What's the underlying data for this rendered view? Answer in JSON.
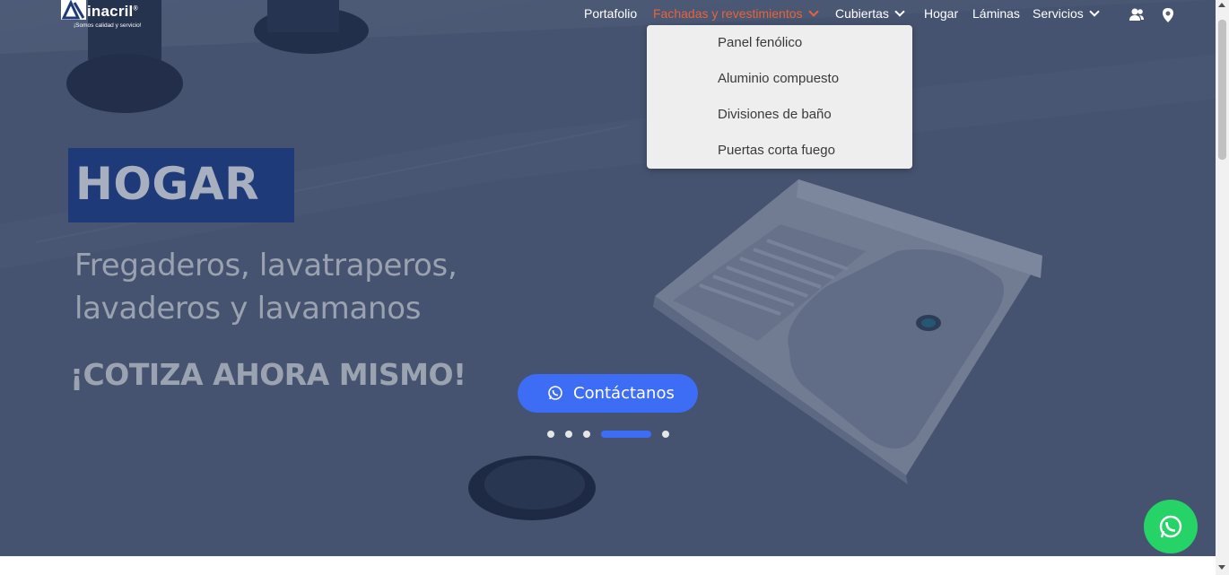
{
  "brand": {
    "name": "inacril",
    "registered_mark": "®",
    "tagline": "¡Somos calidad y servicio!"
  },
  "nav": {
    "items": [
      {
        "label": "Portafolio",
        "has_dropdown": false,
        "active": false
      },
      {
        "label": "Fachadas y revestimientos",
        "has_dropdown": true,
        "active": true
      },
      {
        "label": "Cubiertas",
        "has_dropdown": true,
        "active": false
      },
      {
        "label": "Hogar",
        "has_dropdown": false,
        "active": false
      },
      {
        "label": "Láminas",
        "has_dropdown": false,
        "active": false
      },
      {
        "label": "Servicios",
        "has_dropdown": true,
        "active": false
      }
    ],
    "icons": [
      "users-icon",
      "location-pin-icon"
    ],
    "active_color": "#e8633a"
  },
  "dropdown": {
    "items": [
      "Panel fenólico",
      "Aluminio compuesto",
      "Divisiones de baño",
      "Puertas corta fuego"
    ]
  },
  "hero": {
    "title": "HOGAR",
    "subtitle_line1": "Fregaderos, lavatraperos,",
    "subtitle_line2": "lavaderos y lavamanos",
    "cta_text": "¡COTIZA AHORA MISMO!",
    "contact_button": "Contáctanos",
    "slides_count": 5,
    "active_slide": 4,
    "accent_color": "#3d6cf5",
    "title_box_color": "#1e3a78"
  },
  "floating": {
    "whatsapp_icon": "whatsapp-icon",
    "color": "#25d366"
  }
}
